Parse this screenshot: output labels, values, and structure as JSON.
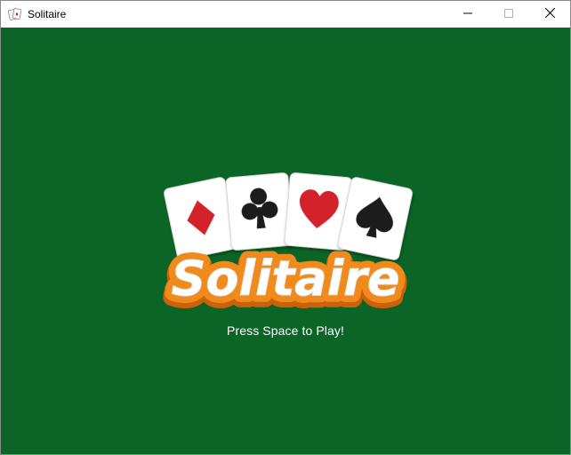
{
  "window": {
    "title": "Solitaire",
    "app_icon": "playing-cards-icon",
    "controls": [
      "minimize-icon",
      "maximize-icon",
      "close-icon"
    ]
  },
  "game": {
    "background_color": "#0a6526",
    "logo": {
      "text": "Solitaire",
      "suits": [
        "diamond",
        "club",
        "heart",
        "spade"
      ],
      "colors": {
        "text_fill": "#ffffff",
        "outline_orange": "#f08a1c",
        "outline_dark_orange": "#c9610d",
        "red_suit": "#d3202a",
        "black_suit": "#1b1b1b"
      }
    },
    "prompt": "Press Space to Play!"
  }
}
